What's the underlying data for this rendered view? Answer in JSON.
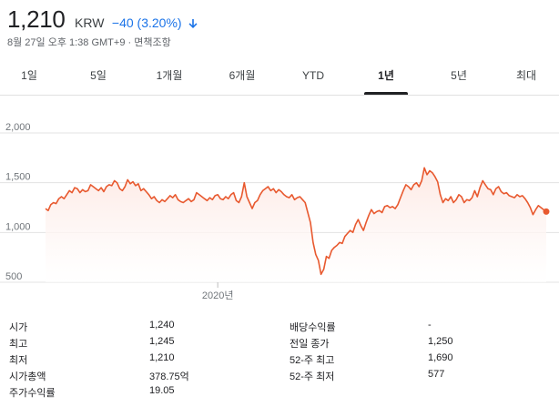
{
  "quote": {
    "price": "1,210",
    "currency": "KRW",
    "change": "−40 (3.20%)",
    "timestamp": "8월 27일 오후 1:38 GMT+9 · 면책조항",
    "down_color": "#1a73e8"
  },
  "tabs": [
    {
      "label": "1일",
      "active": false
    },
    {
      "label": "5일",
      "active": false
    },
    {
      "label": "1개월",
      "active": false
    },
    {
      "label": "6개월",
      "active": false
    },
    {
      "label": "YTD",
      "active": false
    },
    {
      "label": "1년",
      "active": true
    },
    {
      "label": "5년",
      "active": false
    },
    {
      "label": "최대",
      "active": false
    }
  ],
  "chart_data": {
    "type": "area",
    "title": "",
    "xlabel": "",
    "ylabel": "",
    "ylim": [
      500,
      2000
    ],
    "yticks": [
      "2,000",
      "1,500",
      "1,000",
      "500"
    ],
    "xticks": [
      "2020년"
    ],
    "grid": true,
    "line_color": "#e8592f",
    "fill_color": "#fde9e4",
    "series": [
      {
        "values": [
          1240,
          1220,
          1280,
          1300,
          1290,
          1340,
          1360,
          1340,
          1380,
          1420,
          1400,
          1450,
          1440,
          1400,
          1430,
          1410,
          1420,
          1480,
          1460,
          1440,
          1420,
          1450,
          1410,
          1460,
          1480,
          1470,
          1520,
          1500,
          1440,
          1420,
          1460,
          1530,
          1490,
          1510,
          1470,
          1490,
          1420,
          1440,
          1410,
          1380,
          1340,
          1360,
          1320,
          1300,
          1330,
          1310,
          1340,
          1370,
          1350,
          1380,
          1330,
          1310,
          1300,
          1320,
          1340,
          1310,
          1330,
          1400,
          1380,
          1360,
          1340,
          1320,
          1350,
          1330,
          1370,
          1380,
          1340,
          1330,
          1360,
          1340,
          1380,
          1400,
          1320,
          1300,
          1360,
          1500,
          1360,
          1300,
          1240,
          1300,
          1320,
          1380,
          1420,
          1440,
          1460,
          1420,
          1440,
          1400,
          1430,
          1410,
          1380,
          1360,
          1350,
          1380,
          1330,
          1350,
          1360,
          1330,
          1300,
          1200,
          1100,
          900,
          780,
          720,
          580,
          630,
          760,
          740,
          820,
          850,
          870,
          900,
          890,
          960,
          990,
          1020,
          1000,
          1080,
          1130,
          1070,
          1020,
          1100,
          1170,
          1230,
          1190,
          1210,
          1220,
          1200,
          1260,
          1270,
          1250,
          1260,
          1240,
          1280,
          1350,
          1420,
          1480,
          1460,
          1430,
          1480,
          1500,
          1460,
          1520,
          1650,
          1580,
          1620,
          1600,
          1560,
          1510,
          1380,
          1300,
          1340,
          1320,
          1360,
          1300,
          1330,
          1380,
          1360,
          1300,
          1330,
          1320,
          1350,
          1420,
          1360,
          1450,
          1520,
          1480,
          1440,
          1430,
          1380,
          1440,
          1460,
          1410,
          1390,
          1400,
          1370,
          1360,
          1350,
          1380,
          1360,
          1370,
          1340,
          1300,
          1250,
          1180,
          1230,
          1270,
          1250,
          1230,
          1210
        ]
      }
    ]
  },
  "stats": {
    "rows": [
      {
        "label1": "시가",
        "value1": "1,240",
        "label2": "배당수익률",
        "value2": "-"
      },
      {
        "label1": "최고",
        "value1": "1,245",
        "label2": "전일 종가",
        "value2": "1,250"
      },
      {
        "label1": "최저",
        "value1": "1,210",
        "label2": "52-주 최고",
        "value2": "1,690"
      },
      {
        "label1": "시가총액",
        "value1": "378.75억",
        "label2": "52-주 최저",
        "value2": "577"
      },
      {
        "label1": "주가수익률",
        "value1": "19.05",
        "label2": "",
        "value2": ""
      }
    ]
  }
}
